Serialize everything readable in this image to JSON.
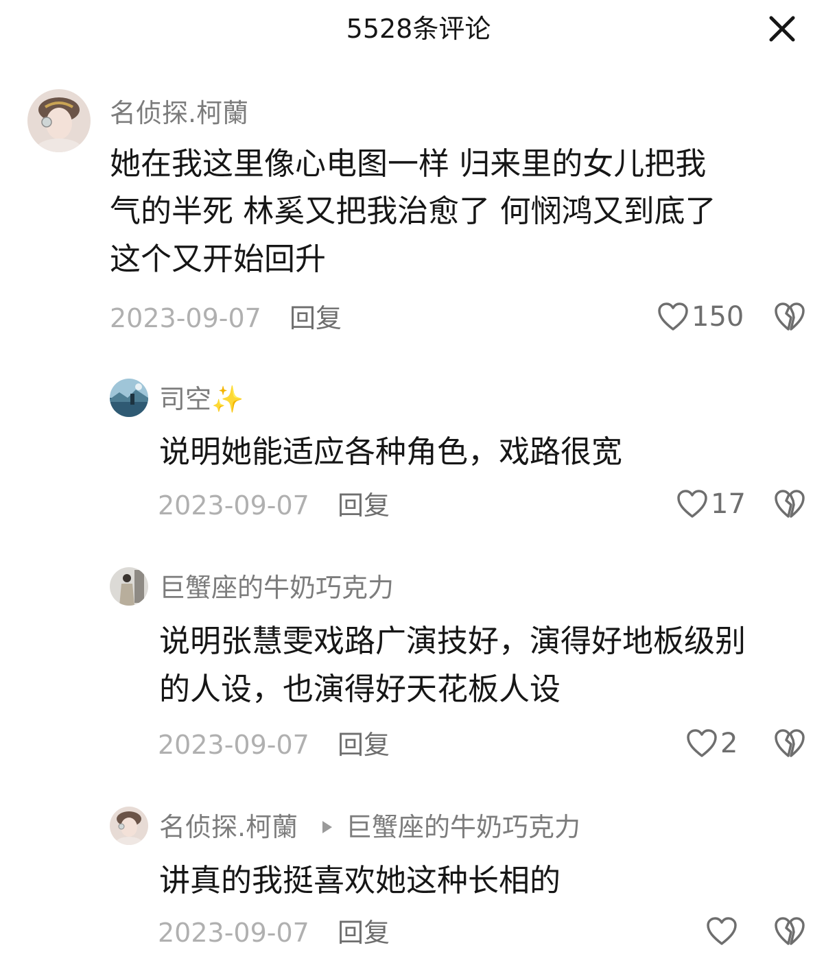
{
  "header": {
    "title": "5528条评论",
    "close_icon": "close-icon"
  },
  "comments": [
    {
      "username": "名侦探.柯蘭",
      "avatar": "avatar",
      "lines": [
        "她在我这里像心电图一样  归来里的女儿把我",
        "气的半死  林奚又把我治愈了  何悯鸿又到底了",
        "这个又开始回升"
      ],
      "date": "2023-09-07",
      "reply_label": "回复",
      "likes": "150"
    },
    {
      "username": "司空",
      "username_emoji": "✨",
      "avatar": "avatar",
      "lines": [
        "说明她能适应各种角色，戏路很宽"
      ],
      "date": "2023-09-07",
      "reply_label": "回复",
      "likes": "17"
    },
    {
      "username": "巨蟹座的牛奶巧克力",
      "avatar": "avatar",
      "lines": [
        "说明张慧雯戏路广演技好，演得好地板级别",
        "的人设，也演得好天花板人设"
      ],
      "date": "2023-09-07",
      "reply_label": "回复",
      "likes": "2"
    },
    {
      "username": "名侦探.柯蘭",
      "reply_to": "巨蟹座的牛奶巧克力",
      "avatar": "avatar",
      "lines": [
        "讲真的我挺喜欢她这种长相的"
      ],
      "date": "2023-09-07",
      "reply_label": "回复",
      "likes": ""
    }
  ],
  "colors": {
    "text_primary": "#161616",
    "text_secondary": "#7c7c7c",
    "text_date": "#b0b0b0",
    "icon": "#6e6e6e"
  }
}
